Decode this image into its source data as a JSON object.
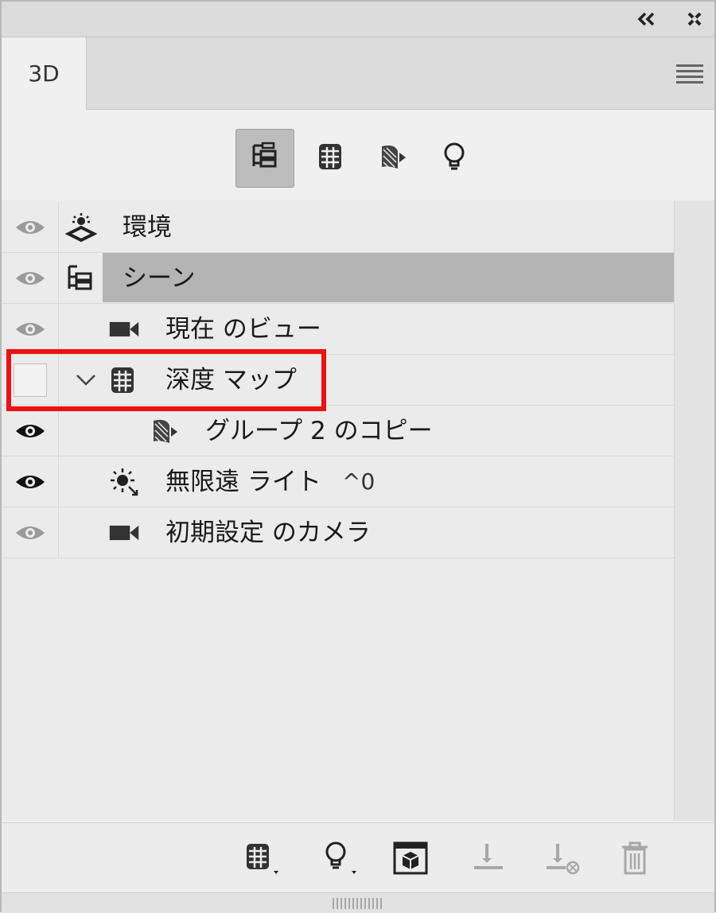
{
  "panel": {
    "tab_label": "3D",
    "title_buttons": [
      "collapse-icon",
      "close-icon"
    ],
    "menu_icon": "hamburger-icon"
  },
  "filter_toolbar": [
    {
      "icon": "scene-tree-icon",
      "active": true
    },
    {
      "icon": "mesh-icon",
      "active": false
    },
    {
      "icon": "material-icon",
      "active": false
    },
    {
      "icon": "light-bulb-icon",
      "active": false
    }
  ],
  "layers": [
    {
      "label": "環境",
      "icon": "environment-icon",
      "visible": "dim",
      "selected": false
    },
    {
      "label": "シーン",
      "icon": "scene-tree-icon",
      "visible": "dim",
      "selected": true
    },
    {
      "label": "現在 のビュー",
      "icon": "camera-icon",
      "visible": "dim",
      "selected": false
    },
    {
      "label": "深度 マップ",
      "icon": "mesh-icon",
      "visible": "off",
      "selected": false,
      "expanded": true,
      "highlighted": true
    },
    {
      "label": "グループ 2 のコピー",
      "icon": "material-icon",
      "visible": "on",
      "selected": false
    },
    {
      "label": "無限遠 ライト",
      "shortcut": "^0",
      "icon": "infinite-light-icon",
      "visible": "on",
      "selected": false
    },
    {
      "label": "初期設定 のカメラ",
      "icon": "camera-icon",
      "visible": "dim",
      "selected": false
    }
  ],
  "bottom_buttons": [
    "add-mesh-icon",
    "add-light-icon",
    "render-icon",
    "ground-drop-icon",
    "remove-from-ground-icon",
    "delete-icon"
  ],
  "colors": {
    "highlight_box": "#ee1111",
    "selected_row": "#b4b4b4",
    "eye_dim": "#9a9a9a",
    "eye_on": "#111111"
  }
}
